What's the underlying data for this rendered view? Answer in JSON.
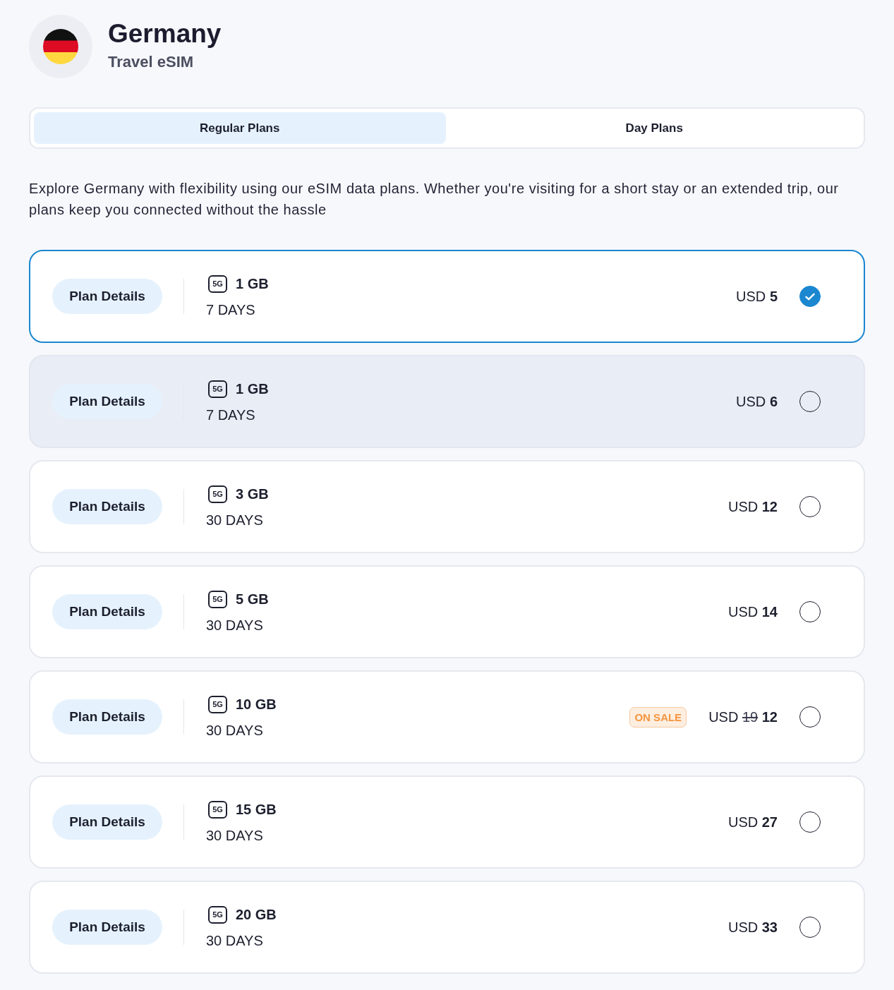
{
  "header": {
    "title": "Germany",
    "subtitle": "Travel eSIM"
  },
  "tabs": [
    {
      "label": "Regular Plans",
      "selected": true
    },
    {
      "label": "Day Plans",
      "selected": false
    }
  ],
  "description": "Explore Germany with flexibility using our eSIM data plans. Whether you're visiting for a short stay or an extended trip, our plans keep you connected without the hassle",
  "plans": [
    {
      "details_label": "Plan Details",
      "network": "5G",
      "data": "1 GB",
      "duration": "7 DAYS",
      "currency": "USD",
      "price": "5",
      "selected": true,
      "highlighted": false
    },
    {
      "details_label": "Plan Details",
      "network": "5G",
      "data": "1 GB",
      "duration": "7 DAYS",
      "currency": "USD",
      "price": "6",
      "selected": false,
      "highlighted": true
    },
    {
      "details_label": "Plan Details",
      "network": "5G",
      "data": "3 GB",
      "duration": "30 DAYS",
      "currency": "USD",
      "price": "12",
      "selected": false,
      "highlighted": false
    },
    {
      "details_label": "Plan Details",
      "network": "5G",
      "data": "5 GB",
      "duration": "30 DAYS",
      "currency": "USD",
      "price": "14",
      "selected": false,
      "highlighted": false
    },
    {
      "details_label": "Plan Details",
      "network": "5G",
      "data": "10 GB",
      "duration": "30 DAYS",
      "badge": "ON SALE",
      "currency": "USD",
      "old_price": "19",
      "price": "12",
      "selected": false,
      "highlighted": false
    },
    {
      "details_label": "Plan Details",
      "network": "5G",
      "data": "15 GB",
      "duration": "30 DAYS",
      "currency": "USD",
      "price": "27",
      "selected": false,
      "highlighted": false
    },
    {
      "details_label": "Plan Details",
      "network": "5G",
      "data": "20 GB",
      "duration": "30 DAYS",
      "currency": "USD",
      "price": "33",
      "selected": false,
      "highlighted": false
    }
  ]
}
